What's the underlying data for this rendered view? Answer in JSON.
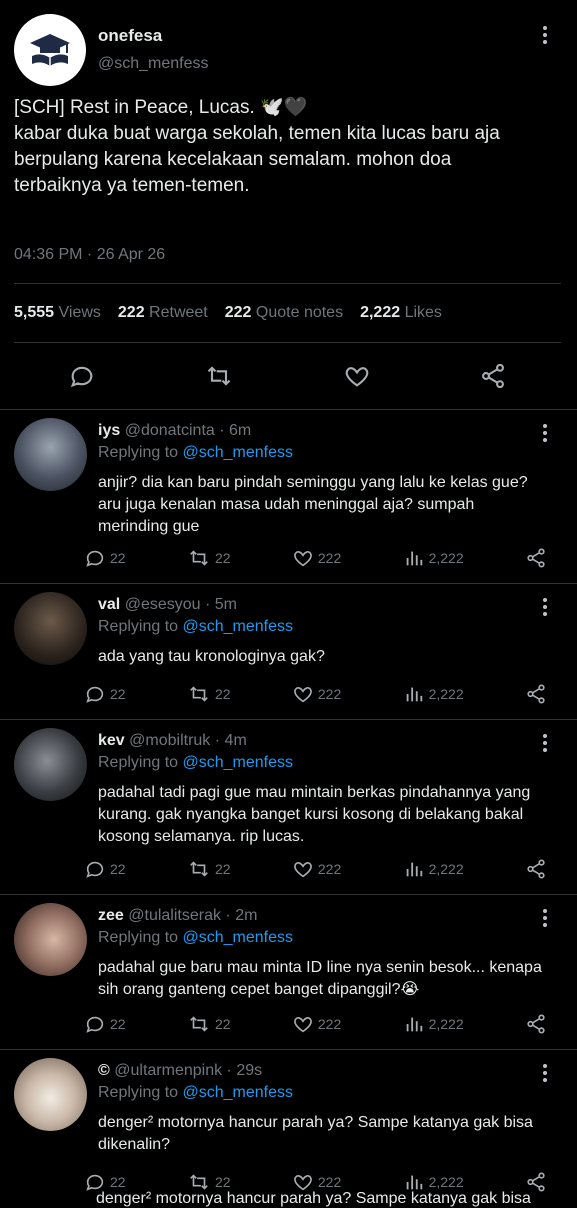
{
  "main_tweet": {
    "display_name": "onefesa",
    "handle": "@sch_menfess",
    "text_lines": [
      "[SCH] Rest in Peace, Lucas. 🕊️🖤",
      "kabar duka buat warga sekolah, temen kita lucas baru aja",
      "berpulang karena kecelakaan semalam. mohon doa",
      "terbaiknya ya temen-temen."
    ],
    "timestamp": "04:36 PM · 26 Apr 26",
    "stats": {
      "views_count": "5,555",
      "views_label": "Views",
      "retweet_count": "222",
      "retweet_label": "Retweet",
      "quote_count": "222",
      "quote_label": "Quote notes",
      "likes_count": "2,222",
      "likes_label": "Likes"
    }
  },
  "replies": [
    {
      "name": "iys",
      "handle": "@donatcinta",
      "time": "· 6m",
      "replying_prefix": "Replying to",
      "replying_to": "@sch_menfess",
      "text_lines": [
        "anjir? dia kan baru pindah seminggu yang lalu ke kelas gue?",
        "aru juga kenalan masa udah meninggal aja? sumpah",
        "merinding gue"
      ],
      "counts": {
        "reply": "22",
        "retweet": "22",
        "like": "222",
        "views": "2,222"
      }
    },
    {
      "name": "val",
      "handle": "@esesyou",
      "time": "· 5m",
      "replying_prefix": "Replying to",
      "replying_to": "@sch_menfess",
      "text_lines": [
        "ada yang tau kronologinya gak?"
      ],
      "counts": {
        "reply": "22",
        "retweet": "22",
        "like": "222",
        "views": "2,222"
      }
    },
    {
      "name": "kev",
      "handle": "@mobiltruk",
      "time": "· 4m",
      "replying_prefix": "Replying to",
      "replying_to": "@sch_menfess",
      "text_lines": [
        "padahal tadi pagi gue mau mintain berkas pindahannya yang",
        "kurang. gak nyangka banget kursi kosong di belakang bakal",
        "kosong selamanya. rip lucas."
      ],
      "counts": {
        "reply": "22",
        "retweet": "22",
        "like": "222",
        "views": "2,222"
      }
    },
    {
      "name": "zee",
      "handle": "@tulalitserak",
      "time": "· 2m",
      "replying_prefix": "Replying to",
      "replying_to": "@sch_menfess",
      "text_lines": [
        "padahal gue baru mau minta ID line nya senin besok... kenapa",
        "sih orang ganteng cepet banget dipanggil?😭"
      ],
      "counts": {
        "reply": "22",
        "retweet": "22",
        "like": "222",
        "views": "2,222"
      }
    },
    {
      "name": "©",
      "handle": "@ultarmenpink",
      "time": "· 29s",
      "replying_prefix": "Replying to",
      "replying_to": "@sch_menfess",
      "text_lines": [
        "denger² motornya hancur parah ya? Sampe katanya gak bisa",
        "dikenalin?"
      ],
      "counts": {
        "reply": "22",
        "retweet": "22",
        "like": "222",
        "views": "2,222"
      }
    }
  ],
  "clipped_text": "denger² motornya hancur parah ya? Sampe katanya gak bisa",
  "colors": {
    "background": "#000000",
    "text": "#e7e9ea",
    "muted": "#71767b",
    "link": "#1d9bf0",
    "divider": "#2f3336"
  }
}
